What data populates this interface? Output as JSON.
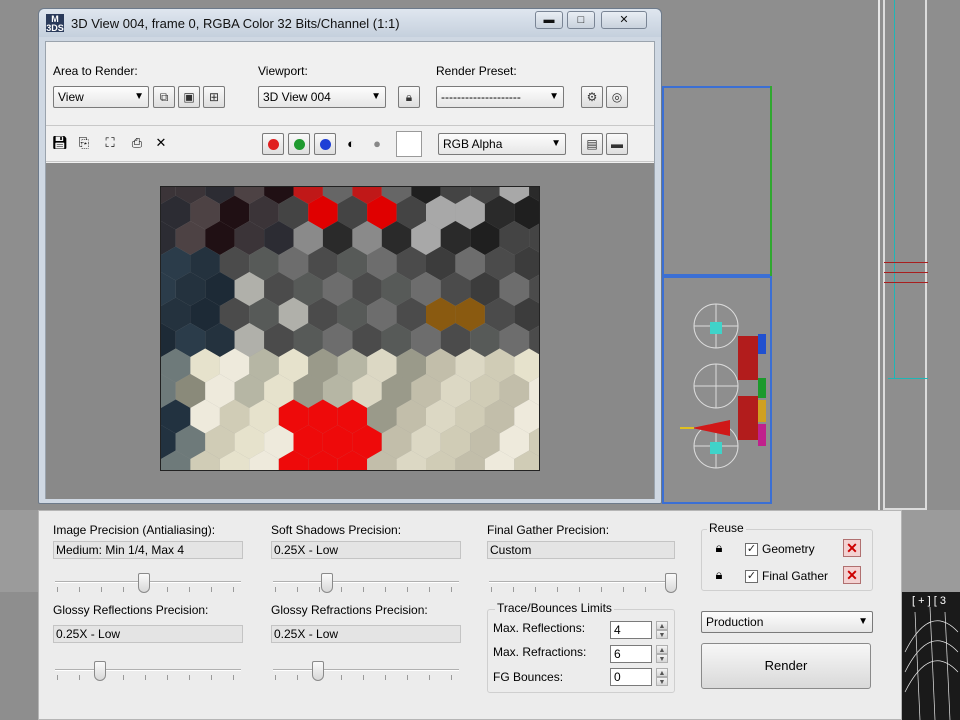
{
  "window": {
    "title": "3D View 004, frame 0, RGBA Color 32 Bits/Channel (1:1)",
    "app_icon": "M\n3DS",
    "minimize_glyph": "▬",
    "maximize_glyph": "□",
    "close_glyph": "✕"
  },
  "toolbar": {
    "area_label": "Area to Render:",
    "area_value": "View",
    "viewport_label": "Viewport:",
    "viewport_value": "3D View 004",
    "preset_label": "Render Preset:",
    "preset_value": "--------------------",
    "channel_value": "RGB Alpha",
    "colors": {
      "red": "#e02020",
      "green": "#1f9a2f",
      "blue": "#1f3fd6"
    }
  },
  "panel": {
    "image_precision_label": "Image Precision (Antialiasing):",
    "image_precision_value": "Medium: Min 1/4, Max 4",
    "soft_shadows_label": "Soft Shadows Precision:",
    "soft_shadows_value": "0.25X - Low",
    "final_gather_label": "Final Gather Precision:",
    "final_gather_value": "Custom",
    "glossy_reflections_label": "Glossy Reflections Precision:",
    "glossy_reflections_value": "0.25X - Low",
    "glossy_refractions_label": "Glossy Refractions Precision:",
    "glossy_refractions_value": "0.25X - Low",
    "trace_group_label": "Trace/Bounces Limits",
    "max_reflections_label": "Max. Reflections:",
    "max_reflections_value": "4",
    "max_refractions_label": "Max. Refractions:",
    "max_refractions_value": "6",
    "fg_bounces_label": "FG Bounces:",
    "fg_bounces_value": "0",
    "reuse_label": "Reuse",
    "reuse_geometry_label": "Geometry",
    "reuse_final_gather_label": "Final Gather",
    "mode_value": "Production",
    "render_button": "Render",
    "sliders": {
      "image_precision": 0.47,
      "soft_shadows": 0.27,
      "final_gather": 1.0,
      "glossy_reflections": 0.22,
      "glossy_refractions": 0.22
    }
  },
  "viewport_label": "[ + ] [ 3"
}
